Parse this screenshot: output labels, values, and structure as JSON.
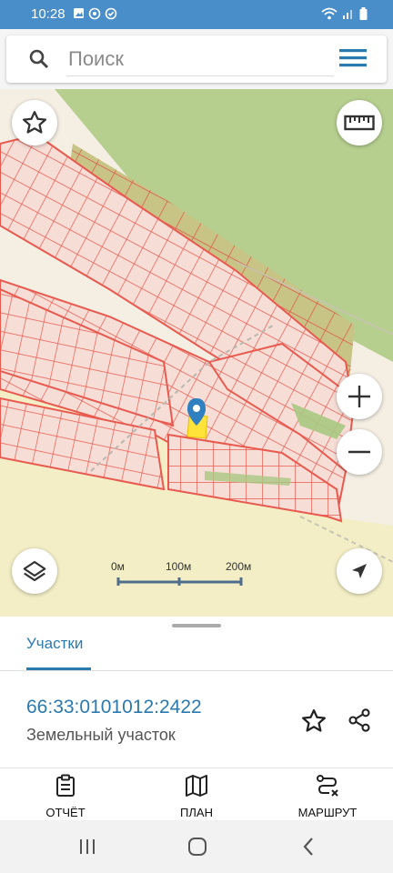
{
  "status_bar": {
    "time": "10:28"
  },
  "search": {
    "placeholder": "Поиск"
  },
  "map": {
    "scale_labels": [
      "0м",
      "100м",
      "200м"
    ],
    "colors": {
      "parcel": "#e85a4f",
      "parcel_fill": "#f6ddd6",
      "forest": "#b6cf8f",
      "field": "#f3eec6",
      "marker": "#2f7fc1",
      "selected_parcel": "#ffe23a"
    }
  },
  "sheet": {
    "tab_label": "Участки",
    "cadastral_number": "66:33:0101012:2422",
    "property_type": "Земельный участок"
  },
  "bottom_nav": {
    "report": "ОТЧЁТ",
    "plan": "ПЛАН",
    "route": "МАРШРУТ"
  }
}
